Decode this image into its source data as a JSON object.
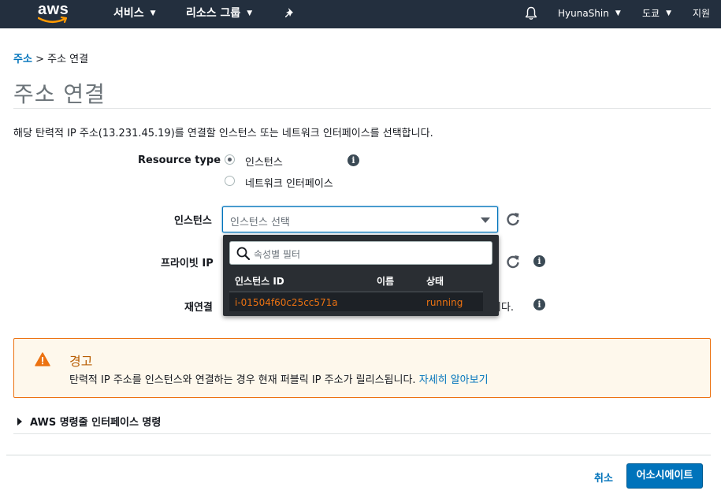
{
  "nav": {
    "logo_text": "aws",
    "services": "서비스",
    "resource_groups": "리소스 그룹",
    "user": "HyunaShin",
    "region": "도쿄",
    "support": "지원"
  },
  "breadcrumb": {
    "root": "주소",
    "separator": ">",
    "current": "주소 연결"
  },
  "page_title": "주소 연결",
  "description": "해당 탄력적 IP 주소(13.231.45.19)를 연결할 인스턴스 또는 네트워크 인터페이스를 선택합니다.",
  "form": {
    "resource_type_label": "Resource type",
    "resource_type_options": [
      {
        "label": "인스턴스",
        "selected": true
      },
      {
        "label": "네트워크 인터페이스",
        "selected": false
      }
    ],
    "instance_label": "인스턴스",
    "instance_placeholder": "인스턴스 선택",
    "private_ip_label": "프라이빗 IP",
    "reassociation_label": "재연결",
    "reassociation_tail": "니다."
  },
  "dropdown": {
    "filter_placeholder": "속성별 필터",
    "columns": [
      "인스턴스 ID",
      "이름",
      "상태"
    ],
    "rows": [
      {
        "id": "i-01504f60c25cc571a",
        "name": "",
        "state": "running"
      }
    ]
  },
  "alert": {
    "heading": "경고",
    "body": "탄력적 IP 주소를 인스턴스와 연결하는 경우 현재 퍼블릭 IP 주소가 릴리스됩니다.",
    "link": "자세히 알아보기"
  },
  "cli_section": "AWS 명령줄 인터페이스 명령",
  "actions": {
    "cancel": "취소",
    "associate": "어소시에이트"
  },
  "colors": {
    "nav_bg": "#232f3e",
    "link": "#0073bb",
    "primary_button": "#0073bb",
    "warning": "#ec7211",
    "dropdown_bg": "#2a2e33"
  },
  "icons": [
    "aws-logo",
    "chevron-down-icon",
    "pin-icon",
    "bell-icon",
    "info-icon",
    "refresh-icon",
    "search-icon",
    "warning-icon",
    "caret-right-icon"
  ]
}
